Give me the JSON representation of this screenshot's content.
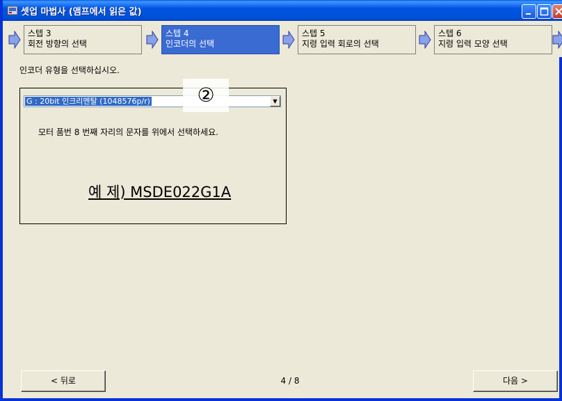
{
  "window": {
    "title": "셋업 마법사 (앰프에서 읽은 값)"
  },
  "steps": [
    {
      "number": "스텝 3",
      "label": "회전 방향의 선택"
    },
    {
      "number": "스텝 4",
      "label": "인코더의 선택",
      "active": true
    },
    {
      "number": "스텝 5",
      "label": "지령 입력 회로의 선택"
    },
    {
      "number": "스텝 6",
      "label": "지령 입력 모양 선택"
    }
  ],
  "instruction": "인코더 유형을 선택하십시오.",
  "encoder_select": {
    "selected": "G : 20bit 인크리멘탈 (1048576p/r)"
  },
  "badge": "②",
  "panel": {
    "hint": "모터 품번 8 번째 자리의 문자를 위에서 선택하세요.",
    "example": "예 제) MSDE022G1A"
  },
  "footer": {
    "back_label": "< 뒤로",
    "next_label": "다음 >",
    "page_indicator": "4 / 8"
  },
  "colors": {
    "titlebar": "#0054e3",
    "active_step": "#3a6bd2",
    "arrow_fill": "#8aa0e8",
    "background": "#ece9d8"
  }
}
